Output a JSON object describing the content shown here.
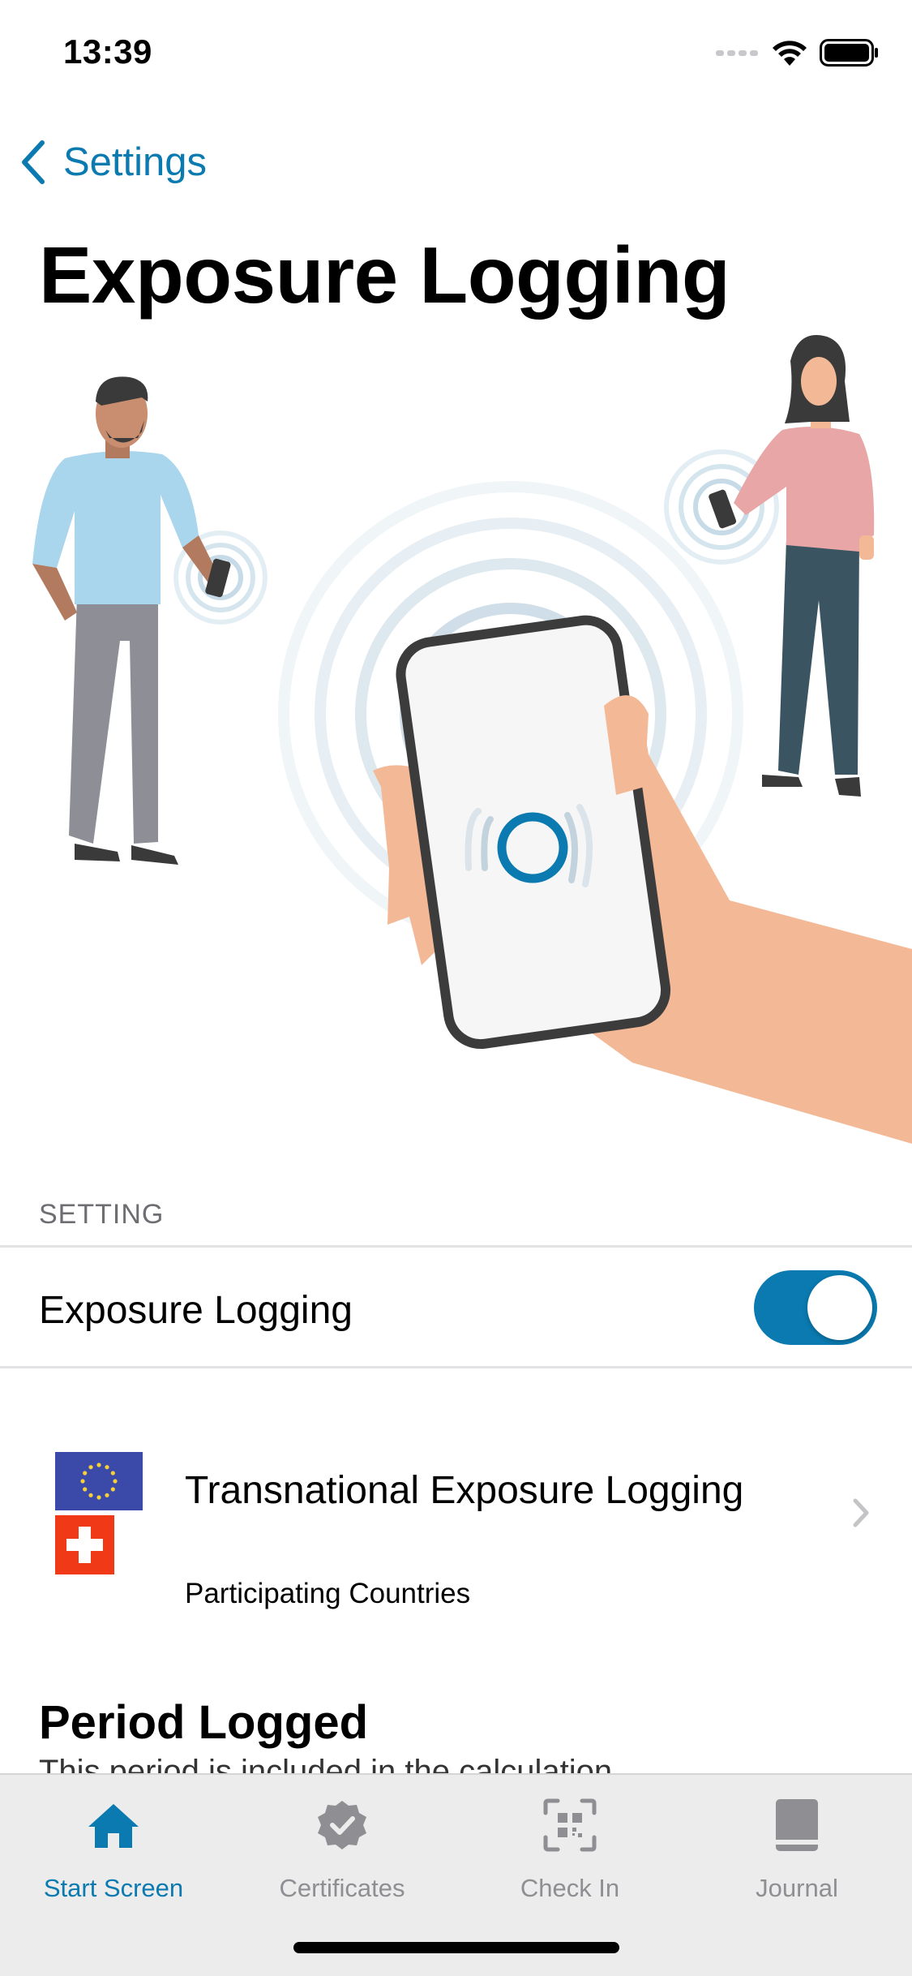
{
  "status_bar": {
    "time": "13:39"
  },
  "nav": {
    "back_label": "Settings"
  },
  "page": {
    "title": "Exposure Logging"
  },
  "settings": {
    "section_header": "SETTING",
    "exposure_logging_label": "Exposure Logging",
    "exposure_logging_enabled": true
  },
  "transnational": {
    "title": "Transnational Exposure Logging",
    "subtitle": "Participating Countries"
  },
  "period": {
    "title": "Period Logged",
    "subtitle": "This period is included in the calculation"
  },
  "tabs": [
    {
      "label": "Start Screen",
      "icon": "home-icon",
      "active": true
    },
    {
      "label": "Certificates",
      "icon": "certificate-badge-icon",
      "active": false
    },
    {
      "label": "Check In",
      "icon": "qr-code-icon",
      "active": false
    },
    {
      "label": "Journal",
      "icon": "journal-book-icon",
      "active": false
    }
  ],
  "colors": {
    "accent": "#0a7ab0",
    "toggle_on": "#0a7ab0",
    "eu_flag": "#3b4aa8",
    "swiss_flag": "#f03a17"
  }
}
